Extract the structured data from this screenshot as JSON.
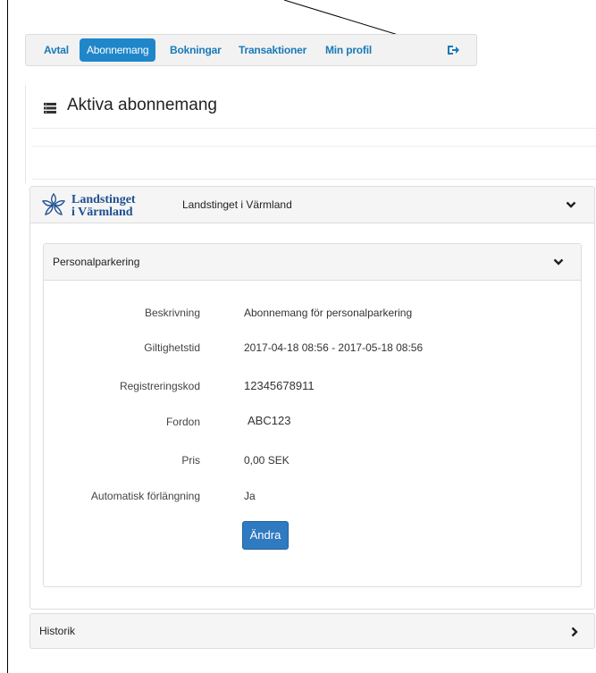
{
  "nav": {
    "items": [
      {
        "label": "Avtal",
        "active": false
      },
      {
        "label": "Abonnemang",
        "active": true
      },
      {
        "label": "Bokningar",
        "active": false
      },
      {
        "label": "Transaktioner",
        "active": false
      },
      {
        "label": "Min profil",
        "active": false
      }
    ],
    "logout_icon": "logout-icon"
  },
  "page": {
    "title": "Aktiva abonnemang",
    "title_icon": "list-icon"
  },
  "organization": {
    "logo_text_line1": "Landstinget",
    "logo_text_line2": "i Värmland",
    "name": "Landstinget i Värmland",
    "expanded": true
  },
  "subscription": {
    "title": "Personalparkering",
    "expanded": true,
    "fields": [
      {
        "label": "Beskrivning",
        "value": "Abonnemang för personalparkering"
      },
      {
        "label": "Giltighetstid",
        "value": "2017-04-18 08:56 - 2017-05-18 08:56"
      },
      {
        "label": "Registreringskod",
        "value": "12345678911"
      },
      {
        "label": "Fordon",
        "value": "ABC123"
      },
      {
        "label": "Pris",
        "value": "0,00 SEK"
      },
      {
        "label": "Automatisk förlängning",
        "value": "Ja"
      }
    ],
    "edit_button": "Ändra"
  },
  "history": {
    "title": "Historik",
    "expanded": false
  },
  "colors": {
    "primary": "#1f86c9",
    "button": "#2f7ac0",
    "link": "#1a7ab8",
    "panel_header": "#f5f5f5",
    "logo_blue": "#1d4f91"
  }
}
